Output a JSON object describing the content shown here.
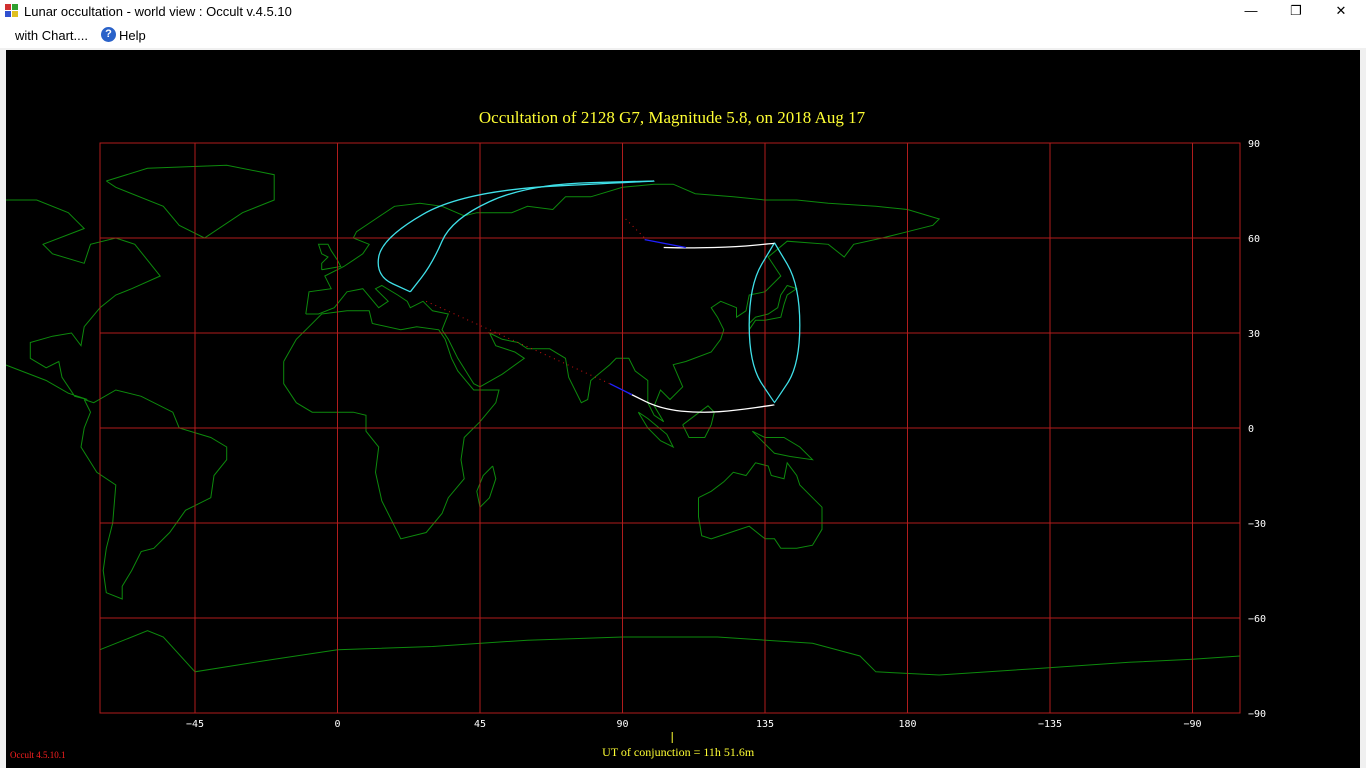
{
  "window": {
    "title": "Lunar occultation  -  world view : Occult v.4.5.10",
    "minimize": "—",
    "maximize": "❐",
    "close": "✕"
  },
  "menu": {
    "with_chart": "with Chart....",
    "help": "Help"
  },
  "chart_data": {
    "type": "map",
    "title": "Occultation  of  2128 G7,      Magnitude 5.8,   on  2018 Aug 17",
    "projection": "equirectangular",
    "xlim": [
      -75,
      285
    ],
    "ylim": [
      -90,
      90
    ],
    "x_tick_values": [
      -45,
      0,
      45,
      90,
      135,
      180,
      225,
      270
    ],
    "x_tick_labels": [
      "−45",
      "0",
      "45",
      "90",
      "135",
      "180",
      "−135",
      "−90"
    ],
    "y_tick_values": [
      90,
      60,
      30,
      0,
      -30,
      -60,
      -90
    ],
    "y_tick_labels": [
      "90",
      "60",
      "30",
      "0",
      "−30",
      "−60",
      "−90"
    ],
    "grid": true,
    "colors": {
      "background": "#000000",
      "grid": "#b01c1c",
      "coastline": "#0d8a0d",
      "limit_curves": "#3fe0e8",
      "central_path": "#ffffff",
      "path_twilight": "#2020ff",
      "path_daylight": "#d01010",
      "title": "#ffff33",
      "tick_labels": "#ffffff"
    },
    "central_path": [
      [
        103,
        57
      ],
      [
        112,
        56.8
      ],
      [
        126,
        57.2
      ],
      [
        138,
        58.3
      ]
    ],
    "central_path_south": [
      [
        92,
        11
      ],
      [
        102,
        6
      ],
      [
        115,
        4.7
      ],
      [
        126,
        5.6
      ],
      [
        138,
        7.3
      ]
    ],
    "limit_north": [
      [
        23,
        43
      ],
      [
        12,
        48
      ],
      [
        14,
        60
      ],
      [
        40,
        75
      ],
      [
        100,
        78
      ]
    ],
    "limit_north_inner": [
      [
        23,
        43
      ],
      [
        30,
        52
      ],
      [
        36,
        66
      ],
      [
        60,
        77
      ],
      [
        100,
        78
      ]
    ],
    "limit_east": [
      [
        138,
        58.5
      ],
      [
        146,
        45
      ],
      [
        146,
        20
      ],
      [
        138,
        8
      ]
    ],
    "limit_west": [
      [
        138,
        58.5
      ],
      [
        130,
        45
      ],
      [
        130,
        20
      ],
      [
        138,
        8
      ]
    ],
    "conjunction_lon": 105.7,
    "conjunction_label": "UT of conjunction = 11h 51.6m"
  },
  "footer": {
    "version": "Occult 4.5.10.1"
  }
}
